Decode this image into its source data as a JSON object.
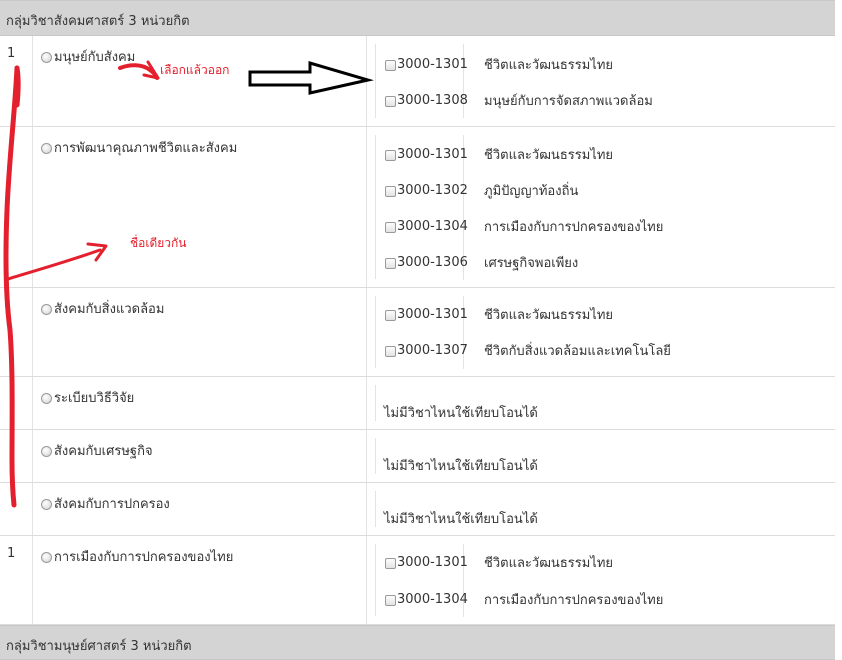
{
  "groups": [
    {
      "label": "กลุ่มวิชาสังคมศาสตร์ 3  หน่วยกิต"
    },
    {
      "label": "กลุ่มวิชามนุษย์ศาสตร์ 3  หน่วยกิต"
    }
  ],
  "rows": [
    {
      "credit": "1",
      "subject": "มนุษย์กับสังคม",
      "courses": [
        {
          "code": "3000-1301",
          "name": "ชีวิตและวัฒนธรรมไทย"
        },
        {
          "code": "3000-1308",
          "name": "มนุษย์กับการจัดสภาพแวดล้อม"
        }
      ]
    },
    {
      "credit": "",
      "subject": "การพัฒนาคุณภาพชีวิตและสังคม",
      "courses": [
        {
          "code": "3000-1301",
          "name": "ชีวิตและวัฒนธรรมไทย"
        },
        {
          "code": "3000-1302",
          "name": "ภูมิปัญญาท้องถิ่น"
        },
        {
          "code": "3000-1304",
          "name": "การเมืองกับการปกครองของไทย"
        },
        {
          "code": "3000-1306",
          "name": "เศรษฐกิจพอเพียง"
        }
      ]
    },
    {
      "credit": "",
      "subject": "สังคมกับสิ่งแวดล้อม",
      "courses": [
        {
          "code": "3000-1301",
          "name": "ชีวิตและวัฒนธรรมไทย"
        },
        {
          "code": "3000-1307",
          "name": "ชีวิตกับสิ่งแวดล้อมและเทคโนโลยี"
        }
      ]
    },
    {
      "credit": "",
      "subject": "ระเบียบวิธีวิจัย",
      "none": "ไม่มีวิชาไหนใช้เทียบโอนได้"
    },
    {
      "credit": "",
      "subject": "สังคมกับเศรษฐกิจ",
      "none": "ไม่มีวิชาไหนใช้เทียบโอนได้"
    },
    {
      "credit": "",
      "subject": "สังคมกับการปกครอง",
      "none": "ไม่มีวิชาไหนใช้เทียบโอนได้"
    },
    {
      "credit": "1",
      "subject": "การเมืองกับการปกครองของไทย",
      "courses": [
        {
          "code": "3000-1301",
          "name": "ชีวิตและวัฒนธรรมไทย"
        },
        {
          "code": "3000-1304",
          "name": "การเมืองกับการปกครองของไทย"
        }
      ]
    }
  ],
  "annotations": {
    "note_select_exit": "เลือกแล้วออก",
    "note_same_name": "ชื่อเดียวกัน",
    "annotation_color": "#e4202e"
  }
}
